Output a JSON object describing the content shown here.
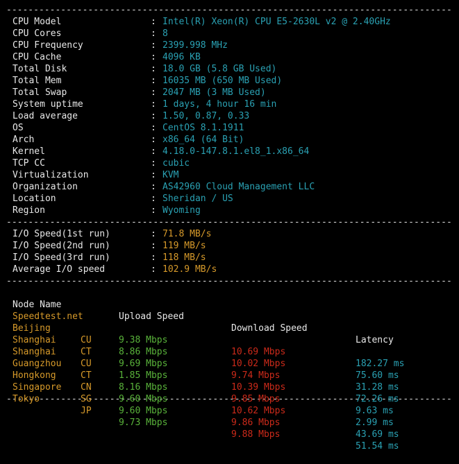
{
  "separator": "----------------------------------------------------------------------------------",
  "system_info": [
    {
      "label": "CPU Model",
      "value": "Intel(R) Xeon(R) CPU E5-2630L v2 @ 2.40GHz"
    },
    {
      "label": "CPU Cores",
      "value": "8"
    },
    {
      "label": "CPU Frequency",
      "value": "2399.998 MHz"
    },
    {
      "label": "CPU Cache",
      "value": "4096 KB"
    },
    {
      "label": "Total Disk",
      "value": "18.0 GB (5.8 GB Used)"
    },
    {
      "label": "Total Mem",
      "value": "16035 MB (650 MB Used)"
    },
    {
      "label": "Total Swap",
      "value": "2047 MB (3 MB Used)"
    },
    {
      "label": "System uptime",
      "value": "1 days, 4 hour 16 min"
    },
    {
      "label": "Load average",
      "value": "1.50, 0.87, 0.33"
    },
    {
      "label": "OS",
      "value": "CentOS 8.1.1911"
    },
    {
      "label": "Arch",
      "value": "x86_64 (64 Bit)"
    },
    {
      "label": "Kernel",
      "value": "4.18.0-147.8.1.el8_1.x86_64"
    },
    {
      "label": "TCP CC",
      "value": "cubic"
    },
    {
      "label": "Virtualization",
      "value": "KVM"
    },
    {
      "label": "Organization",
      "value": "AS42960 Cloud Management LLC"
    },
    {
      "label": "Location",
      "value": "Sheridan / US"
    },
    {
      "label": "Region",
      "value": "Wyoming"
    }
  ],
  "io_speed": [
    {
      "label": "I/O Speed(1st run)",
      "value": "71.8 MB/s"
    },
    {
      "label": "I/O Speed(2nd run)",
      "value": "119 MB/s"
    },
    {
      "label": "I/O Speed(3rd run)",
      "value": "118 MB/s"
    },
    {
      "label": "Average I/O speed",
      "value": "102.9 MB/s"
    }
  ],
  "colon": ":",
  "speed_headers": {
    "node": "Node Name",
    "upload": "Upload Speed",
    "download": "Download Speed",
    "latency": "Latency"
  },
  "speed_rows": [
    {
      "node": "Speedtest.net",
      "code": "",
      "upload": "9.38 Mbps",
      "download": "10.69 Mbps",
      "latency": "182.27 ms"
    },
    {
      "node": "Beijing",
      "code": "CU",
      "upload": "8.86 Mbps",
      "download": "10.02 Mbps",
      "latency": "75.60 ms"
    },
    {
      "node": "Shanghai",
      "code": "CT",
      "upload": "9.69 Mbps",
      "download": "9.74 Mbps",
      "latency": "31.28 ms"
    },
    {
      "node": "Shanghai",
      "code": "CU",
      "upload": "1.85 Mbps",
      "download": "10.39 Mbps",
      "latency": "72.26 ms"
    },
    {
      "node": "Guangzhou",
      "code": "CT",
      "upload": "8.16 Mbps",
      "download": "9.85 Mbps",
      "latency": "9.63 ms"
    },
    {
      "node": "Hongkong",
      "code": "CN",
      "upload": "9.60 Mbps",
      "download": "10.62 Mbps",
      "latency": "2.99 ms"
    },
    {
      "node": "Singapore",
      "code": "SG",
      "upload": "9.60 Mbps",
      "download": "9.86 Mbps",
      "latency": "43.69 ms"
    },
    {
      "node": "Tokyo",
      "code": "JP",
      "upload": "9.73 Mbps",
      "download": "9.88 Mbps",
      "latency": "51.54 ms"
    }
  ],
  "colors": {
    "background": "#000000",
    "label": "#e8e8e8",
    "info_value": "#2aa1b3",
    "io_value": "#d79a2a",
    "node_name": "#d79a2a",
    "upload": "#59b33a",
    "download": "#cc2a1a",
    "latency": "#2aa1b3"
  }
}
